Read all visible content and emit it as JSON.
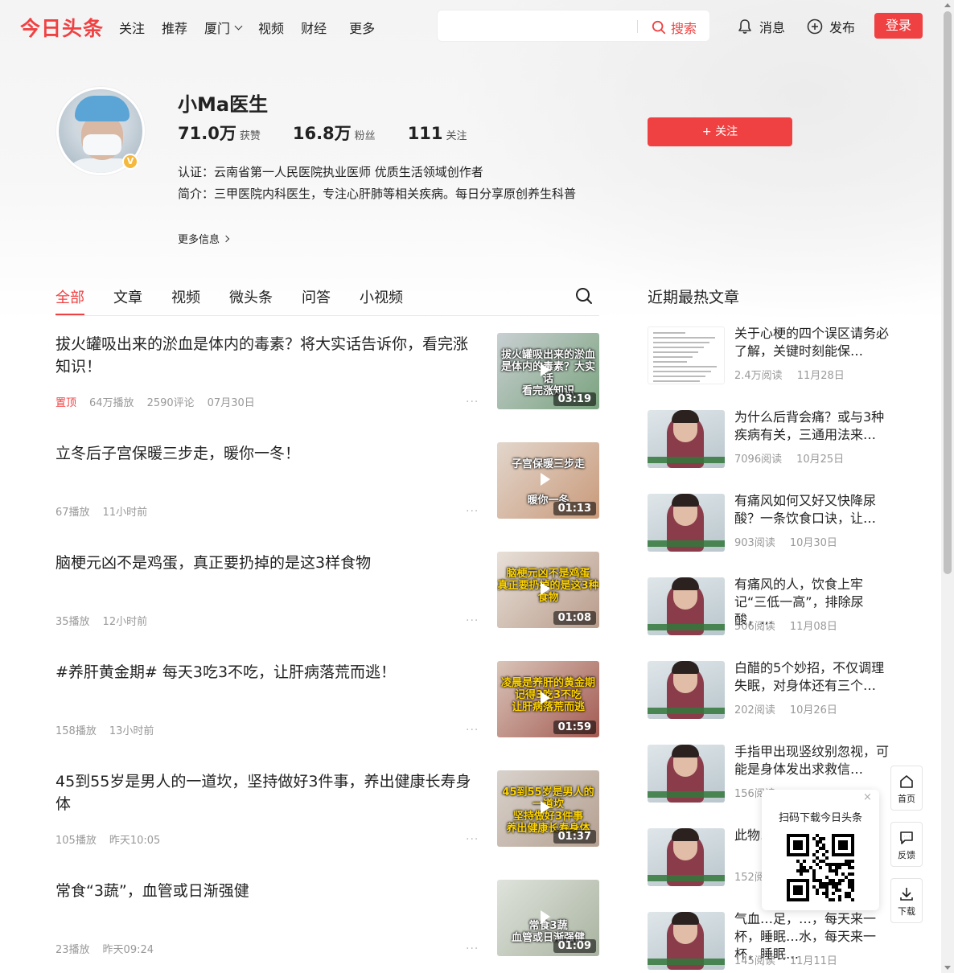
{
  "header": {
    "logo": "今日头条",
    "nav": [
      "关注",
      "推荐",
      "厦门",
      "视频",
      "财经",
      "更多"
    ],
    "search_placeholder": "",
    "search_label": "搜索",
    "messages_label": "消息",
    "publish_label": "发布",
    "login_label": "登录"
  },
  "profile": {
    "name": "小Ma医生",
    "stats": [
      {
        "num": "71.0万",
        "label": "获赞"
      },
      {
        "num": "16.8万",
        "label": "粉丝"
      },
      {
        "num": "111",
        "label": "关注"
      }
    ],
    "certification": "认证：云南省第一人民医院执业医师 优质生活领域创作者",
    "bio": "简介：三甲医院内科医生，专注心肝肺等相关疾病。每日分享原创养生科普",
    "more_info": "更多信息",
    "follow_label": "+ 关注",
    "verified_badge": "V"
  },
  "tabs": [
    "全部",
    "文章",
    "视频",
    "微头条",
    "问答",
    "小视频"
  ],
  "feed": [
    {
      "title": "拔火罐吸出来的淤血是体内的毒素？将大实话告诉你，看完涨知识！",
      "pinned": "置顶",
      "meta": [
        "64万播放",
        "2590评论",
        "07月30日"
      ],
      "duration": "03:19",
      "thumb_caption": "拔火罐吸出来的淤血\n是体内的毒素？大实话\n看完涨知识",
      "caption_yellow": false
    },
    {
      "title": "立冬后子宫保暖三步走，暖你一冬！",
      "pinned": "",
      "meta": [
        "67播放",
        "11小时前"
      ],
      "duration": "01:13",
      "thumb_caption": "子宫保暖三步走\n\n\n暖你一冬",
      "caption_yellow": false
    },
    {
      "title": "脑梗元凶不是鸡蛋，真正要扔掉的是这3样食物",
      "pinned": "",
      "meta": [
        "35播放",
        "12小时前"
      ],
      "duration": "01:08",
      "thumb_caption": "脑梗元凶不是鸡蛋\n真正要扔掉的是这3种食物",
      "caption_yellow": true
    },
    {
      "title": "#养肝黄金期# 每天3吃3不吃，让肝病落荒而逃！",
      "pinned": "",
      "meta": [
        "158播放",
        "13小时前"
      ],
      "duration": "01:59",
      "thumb_caption": "凌晨是养肝的黄金期\n记得3吃3不吃\n让肝病落荒而逃",
      "caption_yellow": true
    },
    {
      "title": "45到55岁是男人的一道坎，坚持做好3件事，养出健康长寿身体",
      "pinned": "",
      "meta": [
        "105播放",
        "昨天10:05"
      ],
      "duration": "01:37",
      "thumb_caption": "45到55岁是男人的一道坎\n坚持做好3件事\n养出健康长寿身体",
      "caption_yellow": true
    },
    {
      "title": "常食“3蔬”，血管或日渐强健",
      "pinned": "",
      "meta": [
        "23播放",
        "昨天09:24"
      ],
      "duration": "01:09",
      "thumb_caption": "\n\n常食3蔬\n血管或日渐强健",
      "caption_yellow": false
    }
  ],
  "hot": {
    "title": "近期最热文章",
    "items": [
      {
        "text": "关于心梗的四个误区请务必了解，关键时刻能保…",
        "reads": "2.4万阅读",
        "date": "11月28日",
        "type": "doc"
      },
      {
        "text": "为什么后背会痛？或与3种疾病有关，三通用法来…",
        "reads": "7096阅读",
        "date": "10月25日",
        "type": "photo"
      },
      {
        "text": "有痛风如何又好又快降尿酸？一条饮食口诀，让…",
        "reads": "903阅读",
        "date": "10月30日",
        "type": "photo"
      },
      {
        "text": "有痛风的人，饮食上牢记“三低一高”，排除尿酸，…",
        "reads": "506阅读",
        "date": "11月08日",
        "type": "photo"
      },
      {
        "text": "白醋的5个妙招，不仅调理失眠，对身体还有三个…",
        "reads": "202阅读",
        "date": "10月26日",
        "type": "photo"
      },
      {
        "text": "手指甲出现竖纹别忽视，可能是身体发出求救信…",
        "reads": "156阅读",
        "date": "",
        "type": "photo"
      },
      {
        "text": "此物…幼都…",
        "reads": "152阅读",
        "date": "",
        "type": "photo"
      },
      {
        "text": "气血…足，…，每天来一杯，睡眠…水，每天来一杯，睡眠…",
        "reads": "145阅读",
        "date": "11月11日",
        "type": "photo"
      }
    ]
  },
  "side": {
    "home": "首页",
    "feedback": "反馈",
    "download": "下载",
    "qr_title": "扫码下载今日头条",
    "close": "×"
  }
}
